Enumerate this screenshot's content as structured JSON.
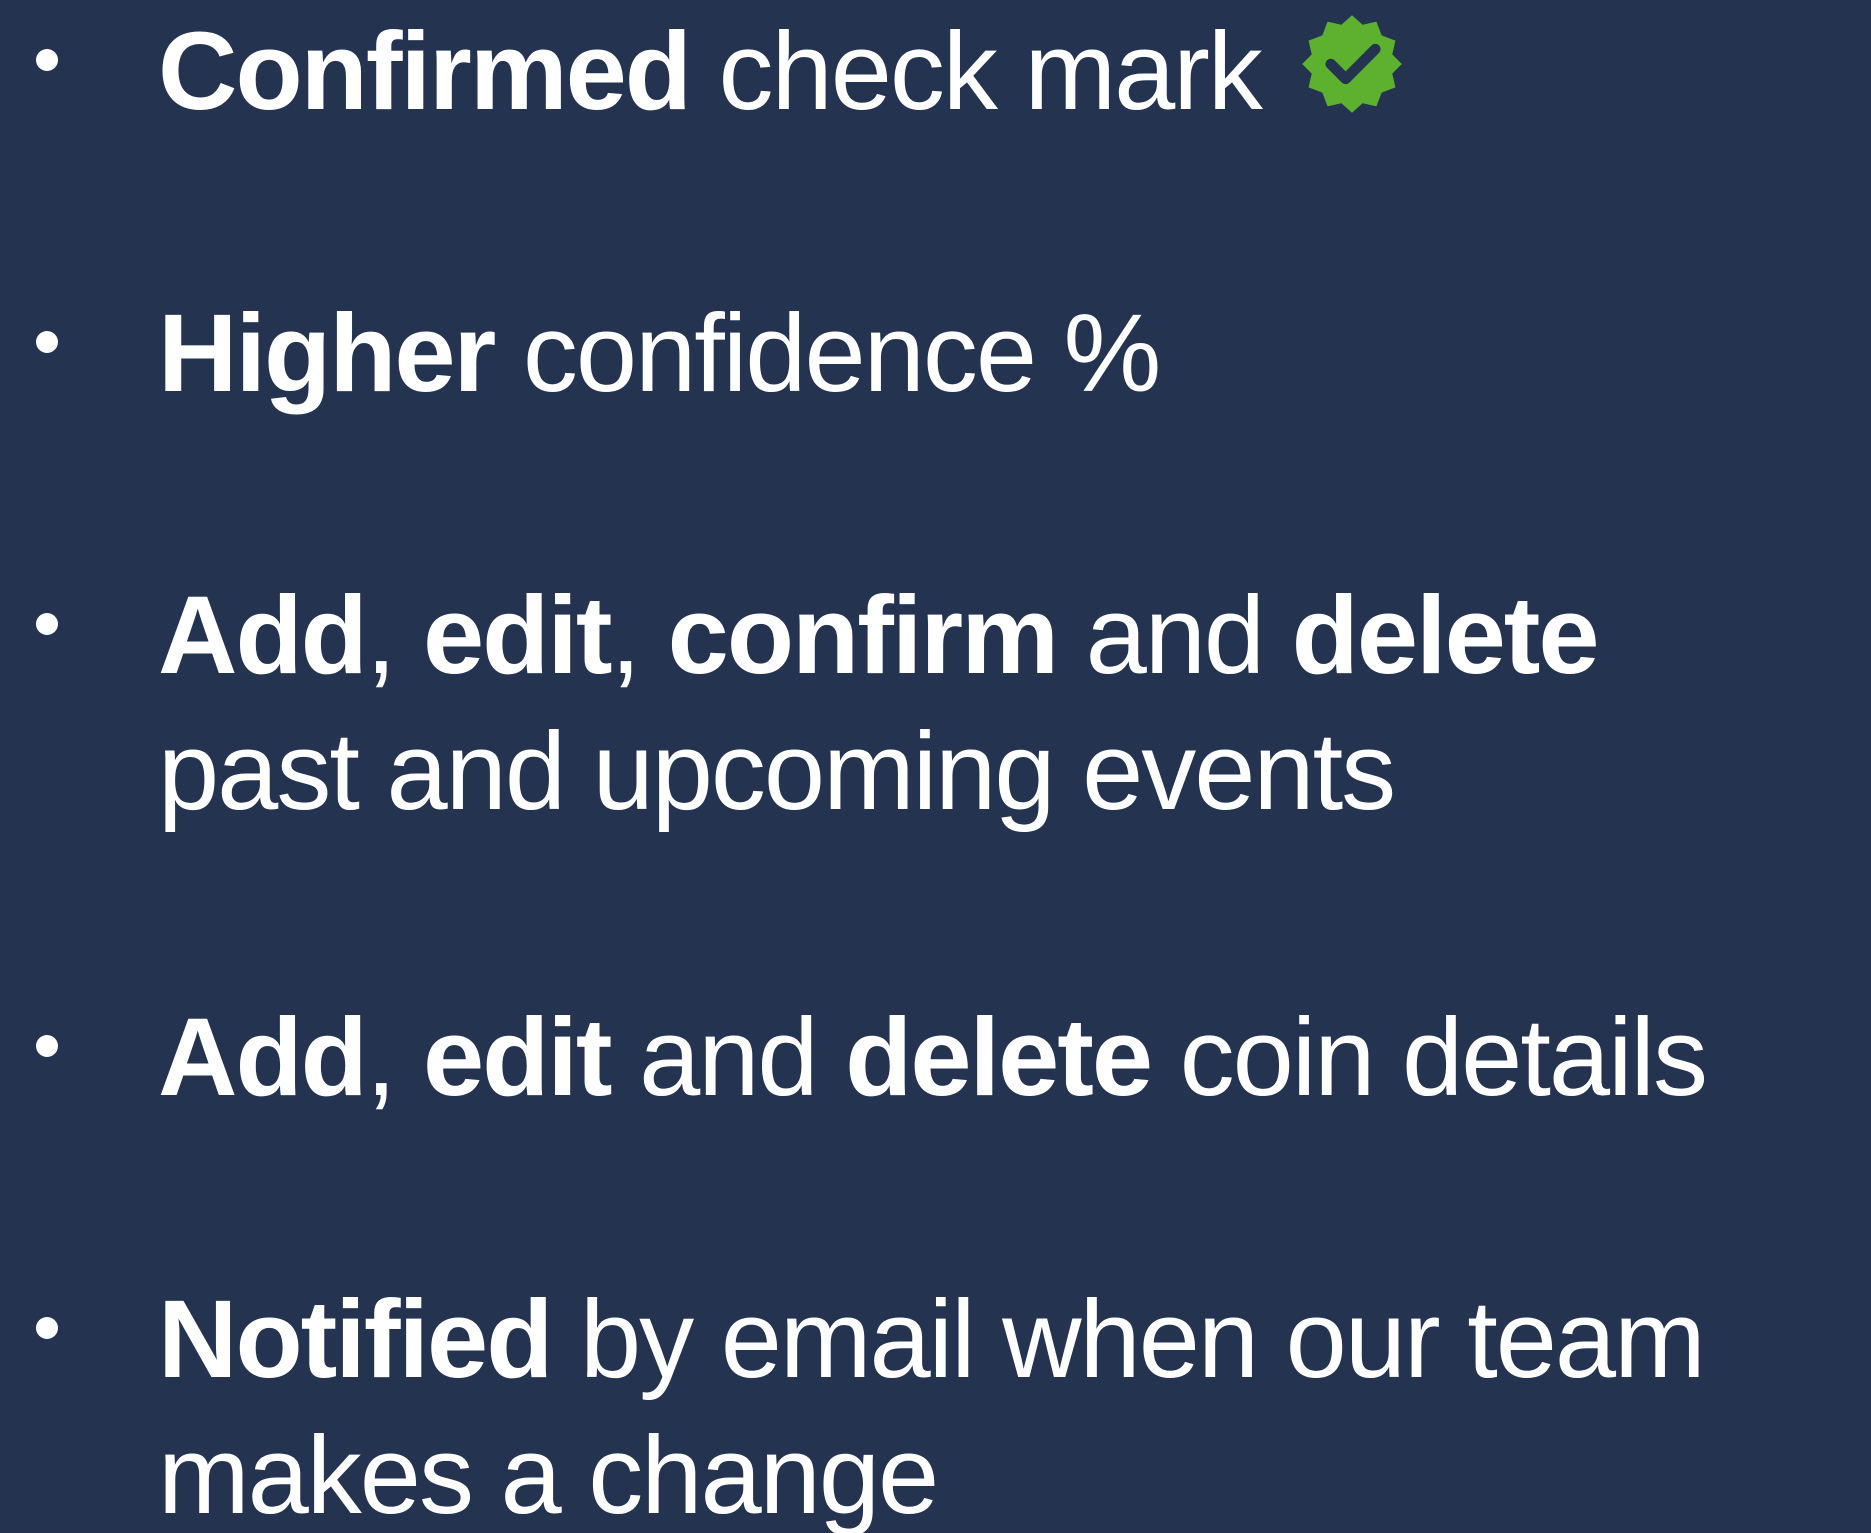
{
  "bullets": [
    {
      "b1": "Confirmed",
      "t1": " check mark"
    },
    {
      "b1": "Higher",
      "t1": " confidence %"
    },
    {
      "b1": "Add",
      "t1": ", ",
      "b2": "edit",
      "t2": ", ",
      "b3": "confirm",
      "t3": " and ",
      "b4": "delete",
      "line2": "past and upcoming events"
    },
    {
      "b1": "Add",
      "t1": ", ",
      "b2": "edit",
      "t2": " and ",
      "b3": "delete",
      "t3": " coin details"
    },
    {
      "b1": "Notified",
      "t1": " by email when our team",
      "line2": "makes a change"
    }
  ],
  "icons": {
    "verified": "verified-check-badge",
    "verified_color": "#5db12f",
    "check_color": "#233350"
  },
  "colors": {
    "background": "#233350",
    "text": "#ffffff"
  }
}
